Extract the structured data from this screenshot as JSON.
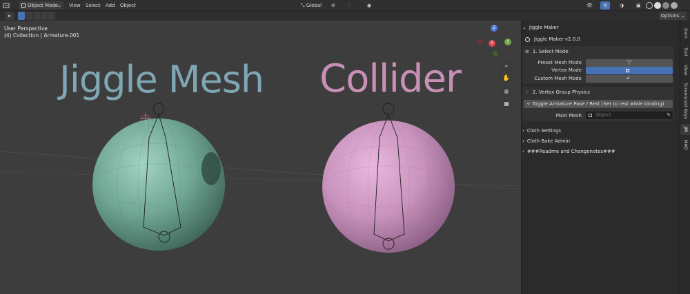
{
  "header": {
    "mode": "Object Mode",
    "menus": [
      "View",
      "Select",
      "Add",
      "Object"
    ],
    "transform": "Global",
    "options": "Options"
  },
  "viewport": {
    "perspective": "User Perspective",
    "collection": "(4) Collection | Armature.001",
    "jiggle_title": "Jiggle Mesh",
    "collider_title": "Collider",
    "gizmo": {
      "z": "Z",
      "y": "Y",
      "x": "X"
    }
  },
  "sidebar": {
    "addon_title": "Jiggle Maker",
    "version": "Jiggle Maker v2.0.0",
    "select_mode": {
      "title": "1. Select Mode",
      "rows": [
        "Preset Mesh Mode",
        "Vertex Mode",
        "Custom Mesh Mode"
      ]
    },
    "vgroup": {
      "title": "2. Vertex Group Physics",
      "toggle_label": "Toggle Armature Pose / Rest (Set to rest while binding)",
      "main_mesh_label": "Main Mesh",
      "main_mesh_placeholder": "Object"
    },
    "collapsed": [
      "Cloth Settings",
      "Cloth Bake Admin",
      "###Readme and Changenotes###"
    ]
  },
  "tabs": [
    "Item",
    "Tool",
    "View",
    "Screencast Keys",
    "JM",
    "MAD"
  ],
  "colors": {
    "jiggle": "#7fa6b3",
    "collider": "#c890b5",
    "accent": "#4772b3"
  }
}
